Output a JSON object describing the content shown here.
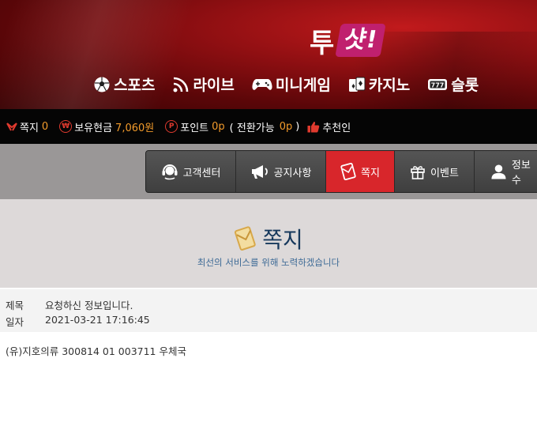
{
  "logo": {
    "part1": "투",
    "part2": "샷!"
  },
  "main_nav": [
    {
      "label": "스포츠",
      "icon": "soccer-ball-icon"
    },
    {
      "label": "라이브",
      "icon": "live-signal-icon"
    },
    {
      "label": "미니게임",
      "icon": "gamepad-icon"
    },
    {
      "label": "카지노",
      "icon": "cards-icon"
    },
    {
      "label": "슬롯",
      "icon": "slot-777-icon"
    }
  ],
  "info_bar": {
    "message_label": "쪽지",
    "message_count": "0",
    "balance_label": "보유현금",
    "balance_value": "7,060원",
    "point_label": "포인트",
    "point_value": "0p",
    "convertible_label": "( 전환가능",
    "convertible_value": "0p",
    "convertible_close": ")",
    "recommend_label": "추천인"
  },
  "sub_nav": [
    {
      "label": "고객센터",
      "icon": "headset-icon",
      "active": false
    },
    {
      "label": "공지사항",
      "icon": "megaphone-icon",
      "active": false
    },
    {
      "label": "쪽지",
      "icon": "message-icon",
      "active": true
    },
    {
      "label": "이벤트",
      "icon": "gift-icon",
      "active": false
    },
    {
      "label": "정보수",
      "icon": "user-icon",
      "active": false
    }
  ],
  "page": {
    "title": "쪽지",
    "subtitle": "최선의 서비스를 위해 노력하겠습니다"
  },
  "message": {
    "subject_label": "제목",
    "subject": "요청하신 정보입니다.",
    "date_label": "일자",
    "date": "2021-03-21 17:16:45",
    "body": "(유)지호의류 300814 01 003711 우체국"
  },
  "colors": {
    "accent": "#d8262b",
    "amount": "#f29b2b",
    "title": "#16385c"
  }
}
